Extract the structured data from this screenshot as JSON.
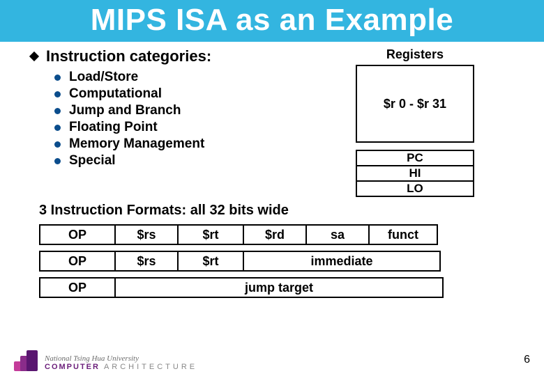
{
  "title": "MIPS ISA as an Example",
  "categories_heading": "Instruction categories:",
  "categories": [
    "Load/Store",
    "Computational",
    "Jump and Branch",
    "Floating Point",
    "Memory Management",
    "Special"
  ],
  "registers": {
    "title": "Registers",
    "main": "$r 0 - $r 31",
    "small": [
      "PC",
      "HI",
      "LO"
    ]
  },
  "formats": {
    "heading": "3 Instruction Formats: all 32 bits wide",
    "rtype": {
      "op": "OP",
      "rs": "$rs",
      "rt": "$rt",
      "rd": "$rd",
      "sa": "sa",
      "funct": "funct"
    },
    "itype": {
      "op": "OP",
      "rs": "$rs",
      "rt": "$rt",
      "imm": "immediate"
    },
    "jtype": {
      "op": "OP",
      "target": "jump target"
    }
  },
  "footer": {
    "org_line1": "National Tsing Hua University",
    "org_line2_strong": "COMPUTER",
    "org_line2_rest": "ARCHITECTURE",
    "page": "6"
  }
}
